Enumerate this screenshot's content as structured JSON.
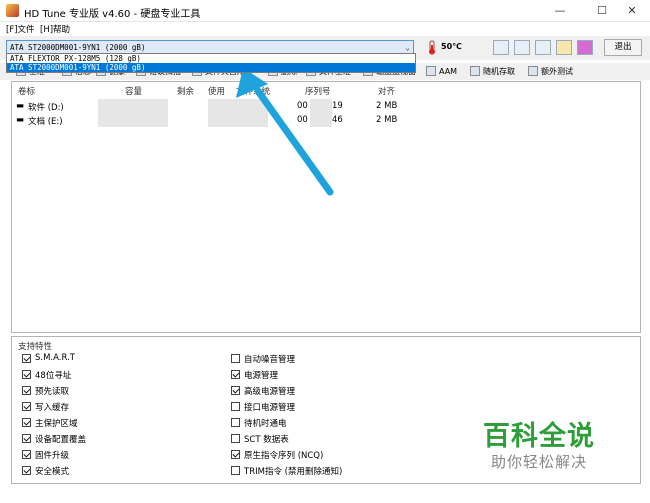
{
  "window": {
    "title": "HD Tune 专业版 v4.60 - 硬盘专业工具",
    "minimize": "—",
    "maximize": "☐",
    "close": "✕"
  },
  "menu": {
    "file": "[F]文件",
    "help": "[H]帮助"
  },
  "toolbar": {
    "drive_selected": "ATA     ST2000DM001-9YN1 (2000 gB)",
    "temperature": "50℃",
    "exit_label": "退出"
  },
  "dropdown": {
    "options": [
      "ATA     FLEXTOR PX-128M5 (128 gB)",
      "ATA     ST2000DM001-9YN1 (2000 gB)"
    ],
    "selected_index": 1
  },
  "tabs": [
    {
      "label": "基准"
    },
    {
      "label": "信息"
    },
    {
      "label": "健康"
    },
    {
      "label": "错误扫描"
    },
    {
      "label": "文件夹占用率"
    },
    {
      "label": "删除"
    },
    {
      "label": "文件基准"
    },
    {
      "label": "磁盘监视器"
    },
    {
      "label": "AAM"
    },
    {
      "label": "随机存取"
    },
    {
      "label": "额外测试"
    }
  ],
  "volumes": {
    "headers": [
      "卷标",
      "容量",
      "剩余",
      "使用",
      "文件系统",
      "序列号",
      "对齐"
    ],
    "rows": [
      {
        "label": "软件 (D:)",
        "serial": "00",
        "serial_end": "19",
        "align": "2 MB"
      },
      {
        "label": "文档 (E:)",
        "serial": "00",
        "serial_end": "46",
        "align": "2 MB"
      }
    ]
  },
  "features": {
    "title": "支持特性",
    "left": [
      {
        "label": "S.M.A.R.T",
        "checked": true
      },
      {
        "label": "48位寻址",
        "checked": true
      },
      {
        "label": "预先读取",
        "checked": true
      },
      {
        "label": "写入缓存",
        "checked": true
      },
      {
        "label": "主保护区域",
        "checked": true
      },
      {
        "label": "设备配置覆盖",
        "checked": true
      },
      {
        "label": "固件升级",
        "checked": true
      },
      {
        "label": "安全模式",
        "checked": true
      }
    ],
    "right": [
      {
        "label": "自动噪音管理",
        "checked": false
      },
      {
        "label": "电源管理",
        "checked": true
      },
      {
        "label": "高级电源管理",
        "checked": true
      },
      {
        "label": "接口电源管理",
        "checked": false
      },
      {
        "label": "待机时通电",
        "checked": false
      },
      {
        "label": "SCT 数据表",
        "checked": false
      },
      {
        "label": "原生指令序列 (NCQ)",
        "checked": true
      },
      {
        "label": "TRIM指令 (禁用删除通知)",
        "checked": false
      }
    ]
  },
  "watermark": {
    "main": "百科全说",
    "sub": "助你轻松解决"
  },
  "colors": {
    "accent": "#0078d7",
    "arrow": "#1fa3dc",
    "watermark_green": "#2e9e3a"
  },
  "icons": {
    "title": "hdtune-app-icon",
    "temp": "thermometer-icon",
    "toolbar": [
      "copy-icon",
      "paste-icon",
      "save-icon",
      "options-icon",
      "download-icon"
    ]
  }
}
